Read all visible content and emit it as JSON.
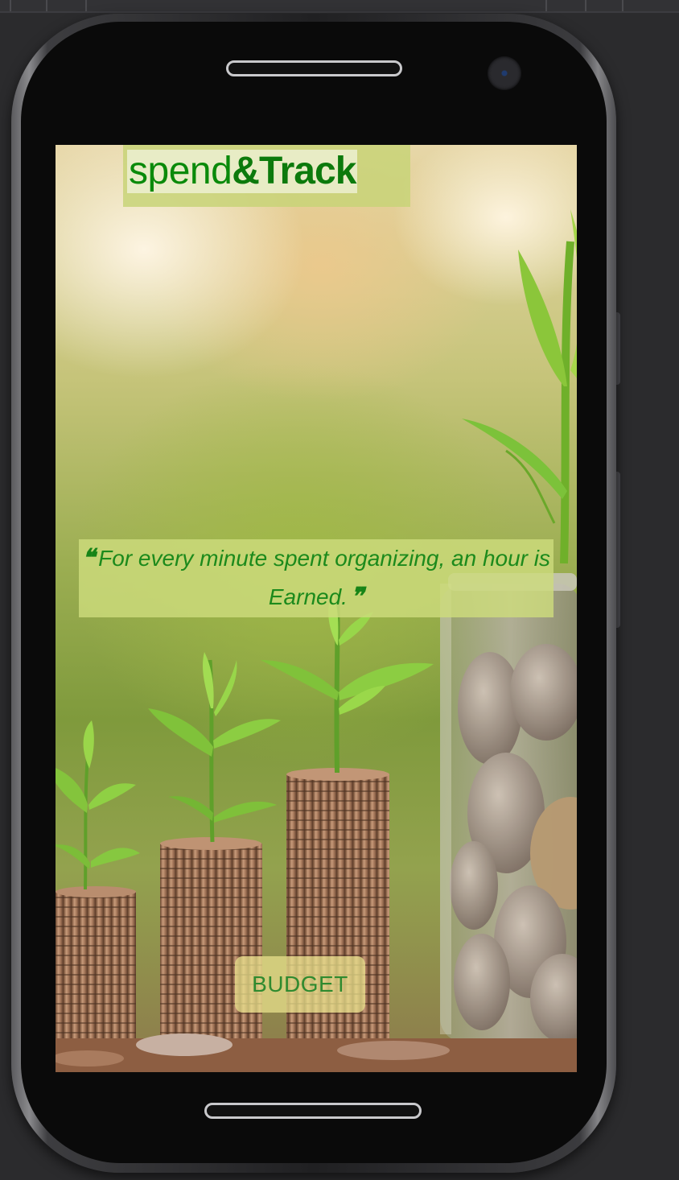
{
  "app": {
    "logo_part1": "spend",
    "logo_part2": "&Track"
  },
  "quote": {
    "open_mark": "❝",
    "text": "For every minute spent organizing, an hour is Earned.",
    "close_mark": "❞"
  },
  "actions": {
    "budget_label": "BUDGET"
  },
  "colors": {
    "brand_green": "#0a8a0a",
    "quote_green": "#1c8a1c",
    "logo_backdrop": "#c8d478",
    "button_bg": "#e8e08c"
  }
}
